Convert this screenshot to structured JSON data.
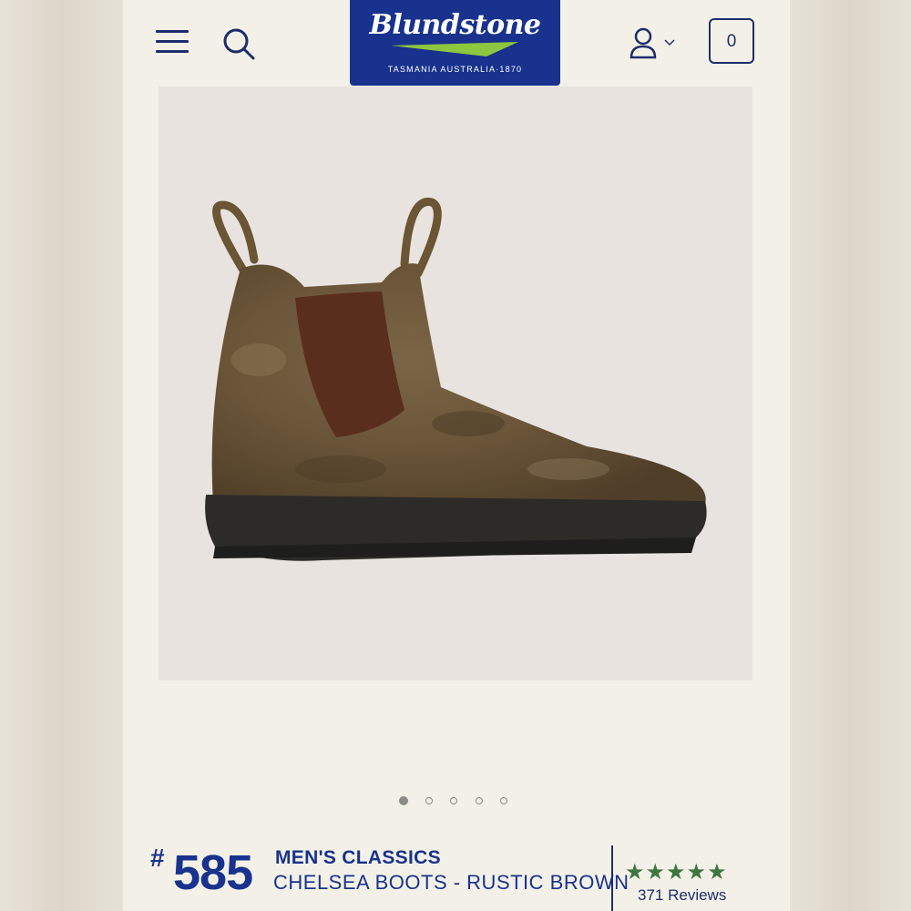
{
  "header": {
    "menu_icon": "hamburger-menu-icon",
    "search_icon": "search-icon",
    "account_icon": "user-icon",
    "cart_count": "0",
    "brand_color": "#18328e"
  },
  "logo": {
    "wordmark": "Blundstone",
    "tagline": "TASMANIA AUSTRALIA·1870",
    "accent_color": "#8dc63f"
  },
  "carousel": {
    "total": 5,
    "active": 0
  },
  "product": {
    "hash": "#",
    "style_number": "585",
    "collection": "MEN'S CLASSICS",
    "name": "CHELSEA BOOTS - RUSTIC BROWN",
    "rating": 5,
    "reviews_label": "371 Reviews",
    "star_color": "#3e7640"
  }
}
